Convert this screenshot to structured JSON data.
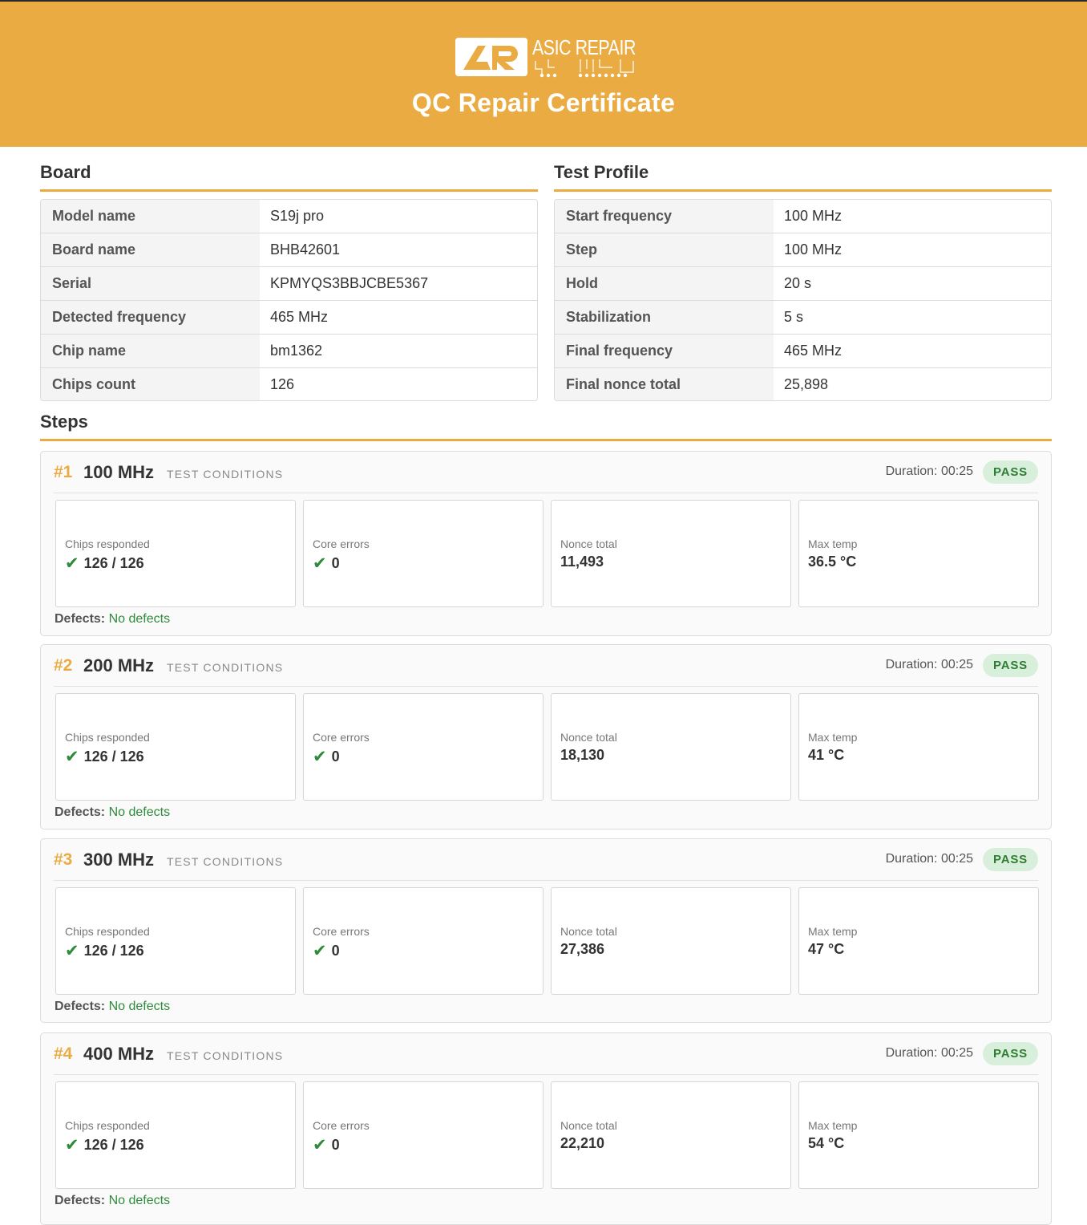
{
  "header": {
    "brand": "ASIC REPAIR",
    "logo_mark": "AR",
    "title": "QC Repair Certificate",
    "background": "#ebab43"
  },
  "board": {
    "title": "Board",
    "rows": [
      {
        "key": "Model name",
        "value": "S19j pro"
      },
      {
        "key": "Board name",
        "value": "BHB42601"
      },
      {
        "key": "Serial",
        "value": "KPMYQS3BBJCBE5367"
      },
      {
        "key": "Detected frequency",
        "value": "465 MHz"
      },
      {
        "key": "Chip name",
        "value": "bm1362"
      },
      {
        "key": "Chips count",
        "value": "126"
      }
    ]
  },
  "test_profile": {
    "title": "Test Profile",
    "rows": [
      {
        "key": "Start frequency",
        "value": "100 MHz"
      },
      {
        "key": "Step",
        "value": "100 MHz"
      },
      {
        "key": "Hold",
        "value": "20 s"
      },
      {
        "key": "Stabilization",
        "value": "5 s"
      },
      {
        "key": "Final frequency",
        "value": "465 MHz"
      },
      {
        "key": "Final nonce total",
        "value": "25,898"
      }
    ]
  },
  "steps_section": {
    "title": "Steps",
    "conditions_label": "TEST CONDITIONS",
    "duration_prefix": "Duration:",
    "defects_label": "Defects:",
    "metric_labels": {
      "chips": "Chips responded",
      "core": "Core errors",
      "nonce": "Nonce total",
      "temp": "Max temp"
    },
    "check_icon": "✔",
    "pass_color": "#2e7d32"
  },
  "steps": [
    {
      "num": "#1",
      "freq": "100 MHz",
      "duration": "00:25",
      "status": "PASS",
      "chips": "126 / 126",
      "core_errors": "0",
      "nonce_total": "11,493",
      "max_temp": "36.5 °C",
      "defects": "No defects"
    },
    {
      "num": "#2",
      "freq": "200 MHz",
      "duration": "00:25",
      "status": "PASS",
      "chips": "126 / 126",
      "core_errors": "0",
      "nonce_total": "18,130",
      "max_temp": "41 °C",
      "defects": "No defects"
    },
    {
      "num": "#3",
      "freq": "300 MHz",
      "duration": "00:25",
      "status": "PASS",
      "chips": "126 / 126",
      "core_errors": "0",
      "nonce_total": "27,386",
      "max_temp": "47 °C",
      "defects": "No defects"
    },
    {
      "num": "#4",
      "freq": "400 MHz",
      "duration": "00:25",
      "status": "PASS",
      "chips": "126 / 126",
      "core_errors": "0",
      "nonce_total": "22,210",
      "max_temp": "54 °C",
      "defects": "No defects"
    }
  ]
}
